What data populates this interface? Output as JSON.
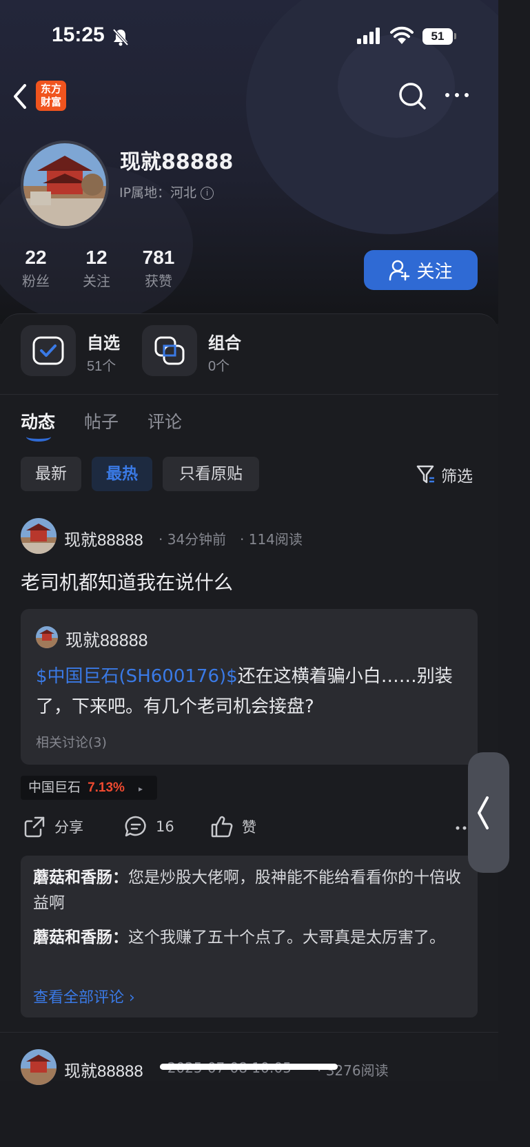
{
  "status_bar": {
    "time": "15:25",
    "battery": "51",
    "icons": [
      "bell-muted-icon",
      "signal-icon",
      "wifi-icon",
      "battery-icon"
    ]
  },
  "nav": {
    "logo_line1": "东方",
    "logo_line2": "财富",
    "logo_color": "#f0541e",
    "icons": [
      "back-icon",
      "search-icon",
      "more-icon"
    ]
  },
  "profile": {
    "name": "现就88888",
    "ip_location": "IP属地：河北",
    "info_glyph": "i",
    "stats": [
      {
        "value": "22",
        "label": "粉丝"
      },
      {
        "value": "12",
        "label": "关注"
      },
      {
        "value": "781",
        "label": "获赞"
      }
    ],
    "follow_button": "关注",
    "accent_color": "#2f6ad4"
  },
  "quick_entries": [
    {
      "title": "自选",
      "sub": "51个",
      "icon": "checkbox-icon"
    },
    {
      "title": "组合",
      "sub": "0个",
      "icon": "overlap-squares-icon"
    }
  ],
  "tabs": [
    "动态",
    "帖子",
    "评论"
  ],
  "active_tab": "动态",
  "filter_chips": [
    "最新",
    "最热",
    "只看原贴"
  ],
  "active_chip": "最热",
  "filter_label": "筛选",
  "post": {
    "author": "现就88888",
    "time": "· 34分钟前",
    "reads": "· 114阅读",
    "title": "老司机都知道我在说什么",
    "quote": {
      "author": "现就88888",
      "stock_link": "$中国巨石(SH600176)$",
      "text": "还在这横着骗小白……别装了，下来吧。有几个老司机会接盘?",
      "related": "相关讨论(3)"
    },
    "stock_tag": {
      "name": "中国巨石",
      "change": "7.13%",
      "arrow": "▸"
    },
    "actions": {
      "share": "分享",
      "comments": "16",
      "like": "赞"
    },
    "comments": [
      {
        "user": "蘑菇和香肠",
        "sep": "：",
        "text": "您是炒股大佬啊，股神能不能给看看你的十倍收益啊"
      },
      {
        "user": "蘑菇和香肠",
        "sep": "：",
        "text": "这个我赚了五十个点了。大哥真是太厉害了。"
      }
    ],
    "view_all": "查看全部评论 ›"
  },
  "next_post": {
    "author": "现就88888",
    "time": "· 2025-07-08 10:05",
    "reads": "· 3276阅读"
  }
}
